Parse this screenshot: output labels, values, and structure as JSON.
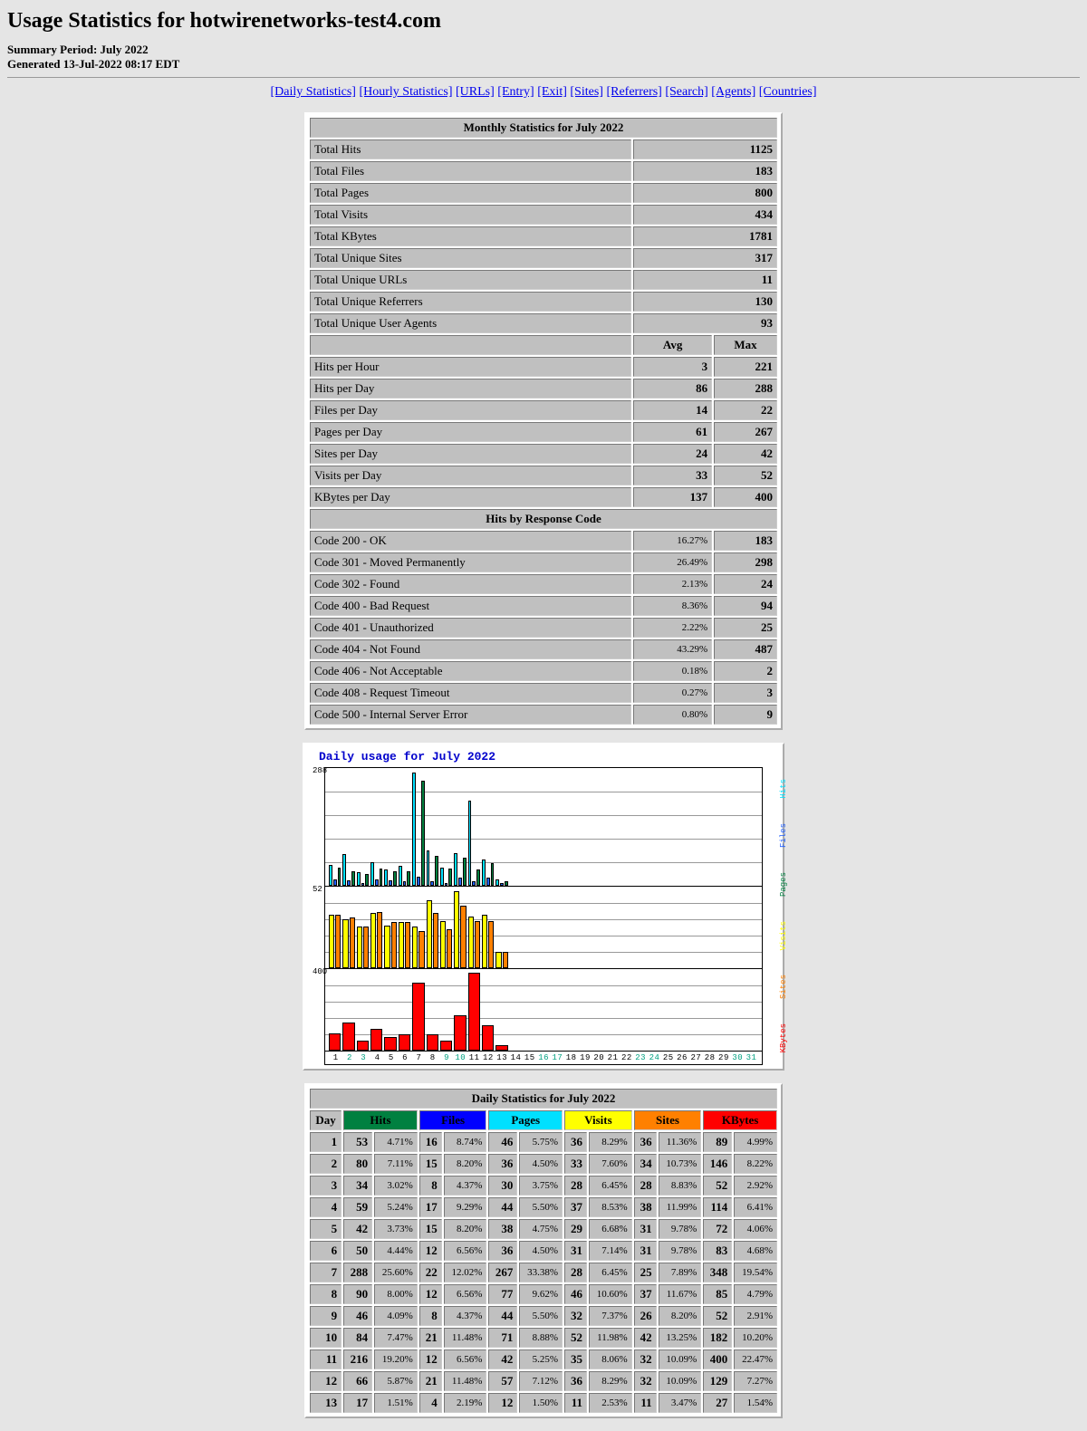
{
  "header": {
    "title": "Usage Statistics for hotwirenetworks-test4.com",
    "period": "Summary Period: July 2022",
    "generated": "Generated 13-Jul-2022 08:17 EDT"
  },
  "nav": [
    "Daily Statistics",
    "Hourly Statistics",
    "URLs",
    "Entry",
    "Exit",
    "Sites",
    "Referrers",
    "Search",
    "Agents",
    "Countries"
  ],
  "monthly": {
    "title": "Monthly Statistics for July 2022",
    "rows1": [
      {
        "label": "Total Hits",
        "value": "1125"
      },
      {
        "label": "Total Files",
        "value": "183"
      },
      {
        "label": "Total Pages",
        "value": "800"
      },
      {
        "label": "Total Visits",
        "value": "434"
      },
      {
        "label": "Total KBytes",
        "value": "1781"
      }
    ],
    "rows2": [
      {
        "label": "Total Unique Sites",
        "value": "317"
      },
      {
        "label": "Total Unique URLs",
        "value": "11"
      },
      {
        "label": "Total Unique Referrers",
        "value": "130"
      },
      {
        "label": "Total Unique User Agents",
        "value": "93"
      }
    ],
    "avgmax_head": {
      "avg": "Avg",
      "max": "Max"
    },
    "rows3": [
      {
        "label": "Hits per Hour",
        "avg": "3",
        "max": "221"
      },
      {
        "label": "Hits per Day",
        "avg": "86",
        "max": "288"
      },
      {
        "label": "Files per Day",
        "avg": "14",
        "max": "22"
      },
      {
        "label": "Pages per Day",
        "avg": "61",
        "max": "267"
      },
      {
        "label": "Sites per Day",
        "avg": "24",
        "max": "42"
      },
      {
        "label": "Visits per Day",
        "avg": "33",
        "max": "52"
      },
      {
        "label": "KBytes per Day",
        "avg": "137",
        "max": "400"
      }
    ],
    "resp_title": "Hits by Response Code",
    "rows4": [
      {
        "label": "Code 200 - OK",
        "pct": "16.27%",
        "value": "183"
      },
      {
        "label": "Code 301 - Moved Permanently",
        "pct": "26.49%",
        "value": "298"
      },
      {
        "label": "Code 302 - Found",
        "pct": "2.13%",
        "value": "24"
      },
      {
        "label": "Code 400 - Bad Request",
        "pct": "8.36%",
        "value": "94"
      },
      {
        "label": "Code 401 - Unauthorized",
        "pct": "2.22%",
        "value": "25"
      },
      {
        "label": "Code 404 - Not Found",
        "pct": "43.29%",
        "value": "487"
      },
      {
        "label": "Code 406 - Not Acceptable",
        "pct": "0.18%",
        "value": "2"
      },
      {
        "label": "Code 408 - Request Timeout",
        "pct": "0.27%",
        "value": "3"
      },
      {
        "label": "Code 500 - Internal Server Error",
        "pct": "0.80%",
        "value": "9"
      }
    ]
  },
  "chart_data": {
    "type": "bar",
    "title": "Daily usage for July 2022",
    "x_categories": [
      1,
      2,
      3,
      4,
      5,
      6,
      7,
      8,
      9,
      10,
      11,
      12,
      13,
      14,
      15,
      16,
      17,
      18,
      19,
      20,
      21,
      22,
      23,
      24,
      25,
      26,
      27,
      28,
      29,
      30,
      31
    ],
    "panels": [
      {
        "ylabel": "288",
        "legend": [
          {
            "name": "Hits",
            "color": "#00E0FF"
          },
          {
            "name": "Files",
            "color": "#2060FF"
          },
          {
            "name": "Pages",
            "color": "#008040"
          }
        ],
        "ylim": [
          0,
          300
        ],
        "series": [
          {
            "name": "Hits",
            "color": "#00E0FF",
            "values": [
              53,
              80,
              34,
              59,
              42,
              50,
              288,
              90,
              46,
              84,
              216,
              66,
              17,
              0,
              0,
              0,
              0,
              0,
              0,
              0,
              0,
              0,
              0,
              0,
              0,
              0,
              0,
              0,
              0,
              0,
              0
            ]
          },
          {
            "name": "Files",
            "color": "#2060FF",
            "values": [
              16,
              15,
              8,
              17,
              15,
              12,
              22,
              12,
              8,
              21,
              12,
              21,
              4,
              0,
              0,
              0,
              0,
              0,
              0,
              0,
              0,
              0,
              0,
              0,
              0,
              0,
              0,
              0,
              0,
              0,
              0
            ]
          },
          {
            "name": "Pages",
            "color": "#008040",
            "values": [
              46,
              36,
              30,
              44,
              38,
              36,
              267,
              77,
              44,
              71,
              42,
              57,
              12,
              0,
              0,
              0,
              0,
              0,
              0,
              0,
              0,
              0,
              0,
              0,
              0,
              0,
              0,
              0,
              0,
              0,
              0
            ]
          }
        ]
      },
      {
        "ylabel": "52",
        "legend": [
          {
            "name": "Visits",
            "color": "#FFFF00"
          },
          {
            "name": "Sites",
            "color": "#FF8000"
          }
        ],
        "ylim": [
          0,
          55
        ],
        "series": [
          {
            "name": "Visits",
            "color": "#FFFF00",
            "values": [
              36,
              33,
              28,
              37,
              29,
              31,
              28,
              46,
              32,
              52,
              35,
              36,
              11,
              0,
              0,
              0,
              0,
              0,
              0,
              0,
              0,
              0,
              0,
              0,
              0,
              0,
              0,
              0,
              0,
              0,
              0
            ]
          },
          {
            "name": "Sites",
            "color": "#FF8000",
            "values": [
              36,
              34,
              28,
              38,
              31,
              31,
              25,
              37,
              26,
              42,
              32,
              32,
              11,
              0,
              0,
              0,
              0,
              0,
              0,
              0,
              0,
              0,
              0,
              0,
              0,
              0,
              0,
              0,
              0,
              0,
              0
            ]
          }
        ]
      },
      {
        "ylabel": "400",
        "legend": [
          {
            "name": "KBytes",
            "color": "#FF0000"
          }
        ],
        "ylim": [
          0,
          420
        ],
        "series": [
          {
            "name": "KBytes",
            "color": "#FF0000",
            "values": [
              89,
              146,
              52,
              114,
              72,
              83,
              348,
              85,
              52,
              182,
              400,
              129,
              27,
              0,
              0,
              0,
              0,
              0,
              0,
              0,
              0,
              0,
              0,
              0,
              0,
              0,
              0,
              0,
              0,
              0,
              0
            ]
          }
        ]
      }
    ],
    "weekend_days": [
      2,
      3,
      9,
      10,
      16,
      17,
      23,
      24,
      30,
      31
    ]
  },
  "daily": {
    "title": "Daily Statistics for July 2022",
    "head": {
      "day": "Day",
      "hits": "Hits",
      "files": "Files",
      "pages": "Pages",
      "visits": "Visits",
      "sites": "Sites",
      "kbytes": "KBytes"
    },
    "rows": [
      {
        "day": "1",
        "hits": "53",
        "hits_p": "4.71%",
        "files": "16",
        "files_p": "8.74%",
        "pages": "46",
        "pages_p": "5.75%",
        "visits": "36",
        "visits_p": "8.29%",
        "sites": "36",
        "sites_p": "11.36%",
        "kb": "89",
        "kb_p": "4.99%"
      },
      {
        "day": "2",
        "hits": "80",
        "hits_p": "7.11%",
        "files": "15",
        "files_p": "8.20%",
        "pages": "36",
        "pages_p": "4.50%",
        "visits": "33",
        "visits_p": "7.60%",
        "sites": "34",
        "sites_p": "10.73%",
        "kb": "146",
        "kb_p": "8.22%"
      },
      {
        "day": "3",
        "hits": "34",
        "hits_p": "3.02%",
        "files": "8",
        "files_p": "4.37%",
        "pages": "30",
        "pages_p": "3.75%",
        "visits": "28",
        "visits_p": "6.45%",
        "sites": "28",
        "sites_p": "8.83%",
        "kb": "52",
        "kb_p": "2.92%"
      },
      {
        "day": "4",
        "hits": "59",
        "hits_p": "5.24%",
        "files": "17",
        "files_p": "9.29%",
        "pages": "44",
        "pages_p": "5.50%",
        "visits": "37",
        "visits_p": "8.53%",
        "sites": "38",
        "sites_p": "11.99%",
        "kb": "114",
        "kb_p": "6.41%"
      },
      {
        "day": "5",
        "hits": "42",
        "hits_p": "3.73%",
        "files": "15",
        "files_p": "8.20%",
        "pages": "38",
        "pages_p": "4.75%",
        "visits": "29",
        "visits_p": "6.68%",
        "sites": "31",
        "sites_p": "9.78%",
        "kb": "72",
        "kb_p": "4.06%"
      },
      {
        "day": "6",
        "hits": "50",
        "hits_p": "4.44%",
        "files": "12",
        "files_p": "6.56%",
        "pages": "36",
        "pages_p": "4.50%",
        "visits": "31",
        "visits_p": "7.14%",
        "sites": "31",
        "sites_p": "9.78%",
        "kb": "83",
        "kb_p": "4.68%"
      },
      {
        "day": "7",
        "hits": "288",
        "hits_p": "25.60%",
        "files": "22",
        "files_p": "12.02%",
        "pages": "267",
        "pages_p": "33.38%",
        "visits": "28",
        "visits_p": "6.45%",
        "sites": "25",
        "sites_p": "7.89%",
        "kb": "348",
        "kb_p": "19.54%"
      },
      {
        "day": "8",
        "hits": "90",
        "hits_p": "8.00%",
        "files": "12",
        "files_p": "6.56%",
        "pages": "77",
        "pages_p": "9.62%",
        "visits": "46",
        "visits_p": "10.60%",
        "sites": "37",
        "sites_p": "11.67%",
        "kb": "85",
        "kb_p": "4.79%"
      },
      {
        "day": "9",
        "hits": "46",
        "hits_p": "4.09%",
        "files": "8",
        "files_p": "4.37%",
        "pages": "44",
        "pages_p": "5.50%",
        "visits": "32",
        "visits_p": "7.37%",
        "sites": "26",
        "sites_p": "8.20%",
        "kb": "52",
        "kb_p": "2.91%"
      },
      {
        "day": "10",
        "hits": "84",
        "hits_p": "7.47%",
        "files": "21",
        "files_p": "11.48%",
        "pages": "71",
        "pages_p": "8.88%",
        "visits": "52",
        "visits_p": "11.98%",
        "sites": "42",
        "sites_p": "13.25%",
        "kb": "182",
        "kb_p": "10.20%"
      },
      {
        "day": "11",
        "hits": "216",
        "hits_p": "19.20%",
        "files": "12",
        "files_p": "6.56%",
        "pages": "42",
        "pages_p": "5.25%",
        "visits": "35",
        "visits_p": "8.06%",
        "sites": "32",
        "sites_p": "10.09%",
        "kb": "400",
        "kb_p": "22.47%"
      },
      {
        "day": "12",
        "hits": "66",
        "hits_p": "5.87%",
        "files": "21",
        "files_p": "11.48%",
        "pages": "57",
        "pages_p": "7.12%",
        "visits": "36",
        "visits_p": "8.29%",
        "sites": "32",
        "sites_p": "10.09%",
        "kb": "129",
        "kb_p": "7.27%"
      },
      {
        "day": "13",
        "hits": "17",
        "hits_p": "1.51%",
        "files": "4",
        "files_p": "2.19%",
        "pages": "12",
        "pages_p": "1.50%",
        "visits": "11",
        "visits_p": "2.53%",
        "sites": "11",
        "sites_p": "3.47%",
        "kb": "27",
        "kb_p": "1.54%"
      }
    ]
  }
}
